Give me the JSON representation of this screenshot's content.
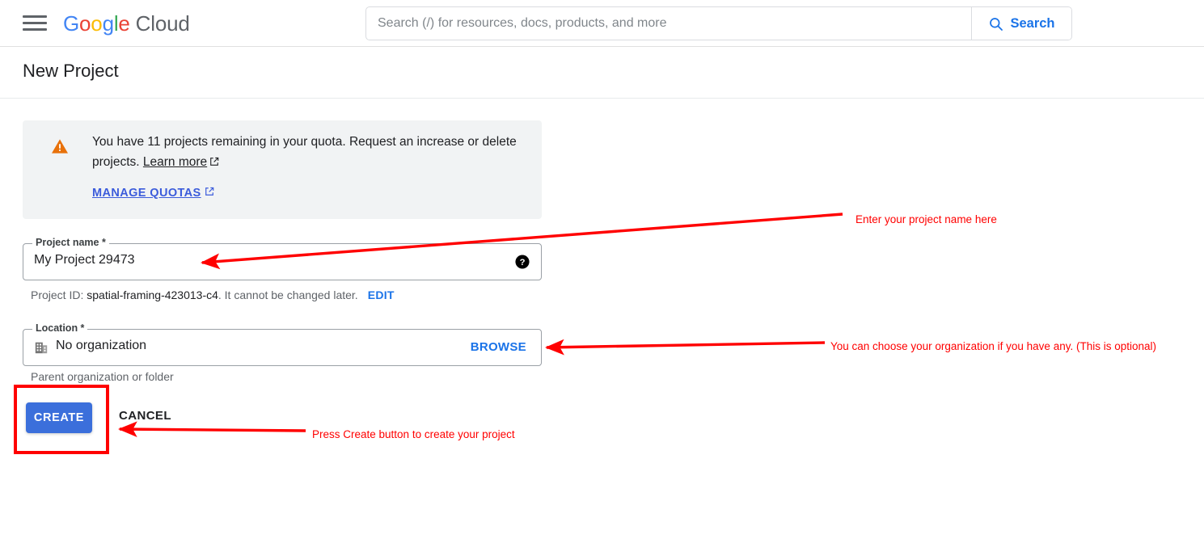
{
  "appbar": {
    "menu_icon": "hamburger-menu-icon",
    "brand": {
      "g1": "G",
      "o1": "o",
      "o2": "o",
      "g2": "g",
      "l1": "l",
      "e1": "e",
      "cloud": "Cloud"
    },
    "search": {
      "placeholder": "Search (/) for resources, docs, products, and more",
      "value": "",
      "button_label": "Search",
      "button_icon": "search-icon"
    }
  },
  "page": {
    "title": "New Project"
  },
  "notice": {
    "icon": "warning-triangle-icon",
    "body_prefix": "You have 11 projects remaining in your quota. Request an increase or delete projects. ",
    "learn_more_label": "Learn more",
    "manage_quotas_label": "MANAGE QUOTAS",
    "external_link_icon": "external-link-icon"
  },
  "form": {
    "project_name": {
      "label": "Project name *",
      "value": "My Project 29473",
      "help_icon": "help-circle-icon"
    },
    "project_id": {
      "prefix": "Project ID: ",
      "id": "spatial-framing-423013-c4",
      "suffix": ". It cannot be changed later.",
      "edit_label": "EDIT"
    },
    "location": {
      "label": "Location *",
      "icon": "organization-building-icon",
      "value": "No organization",
      "browse_label": "BROWSE",
      "helper_text": "Parent organization or folder"
    }
  },
  "actions": {
    "create_label": "CREATE",
    "cancel_label": "CANCEL"
  },
  "annotations": {
    "accent_color": "#ff0000",
    "project_name_note": "Enter your project name here",
    "location_note": "You can choose your organization if you have any. (This is optional)",
    "create_note": "Press Create button to create your project"
  },
  "colors": {
    "google_blue": "#4285F4",
    "google_red": "#EA4335",
    "google_yellow": "#FBBC05",
    "google_green": "#34A853",
    "link_blue": "#1a73e8",
    "button_blue": "#3b6fdb",
    "warning_orange": "#E8710A",
    "notice_bg": "#f1f3f4",
    "annotation_red": "#ff0000"
  }
}
